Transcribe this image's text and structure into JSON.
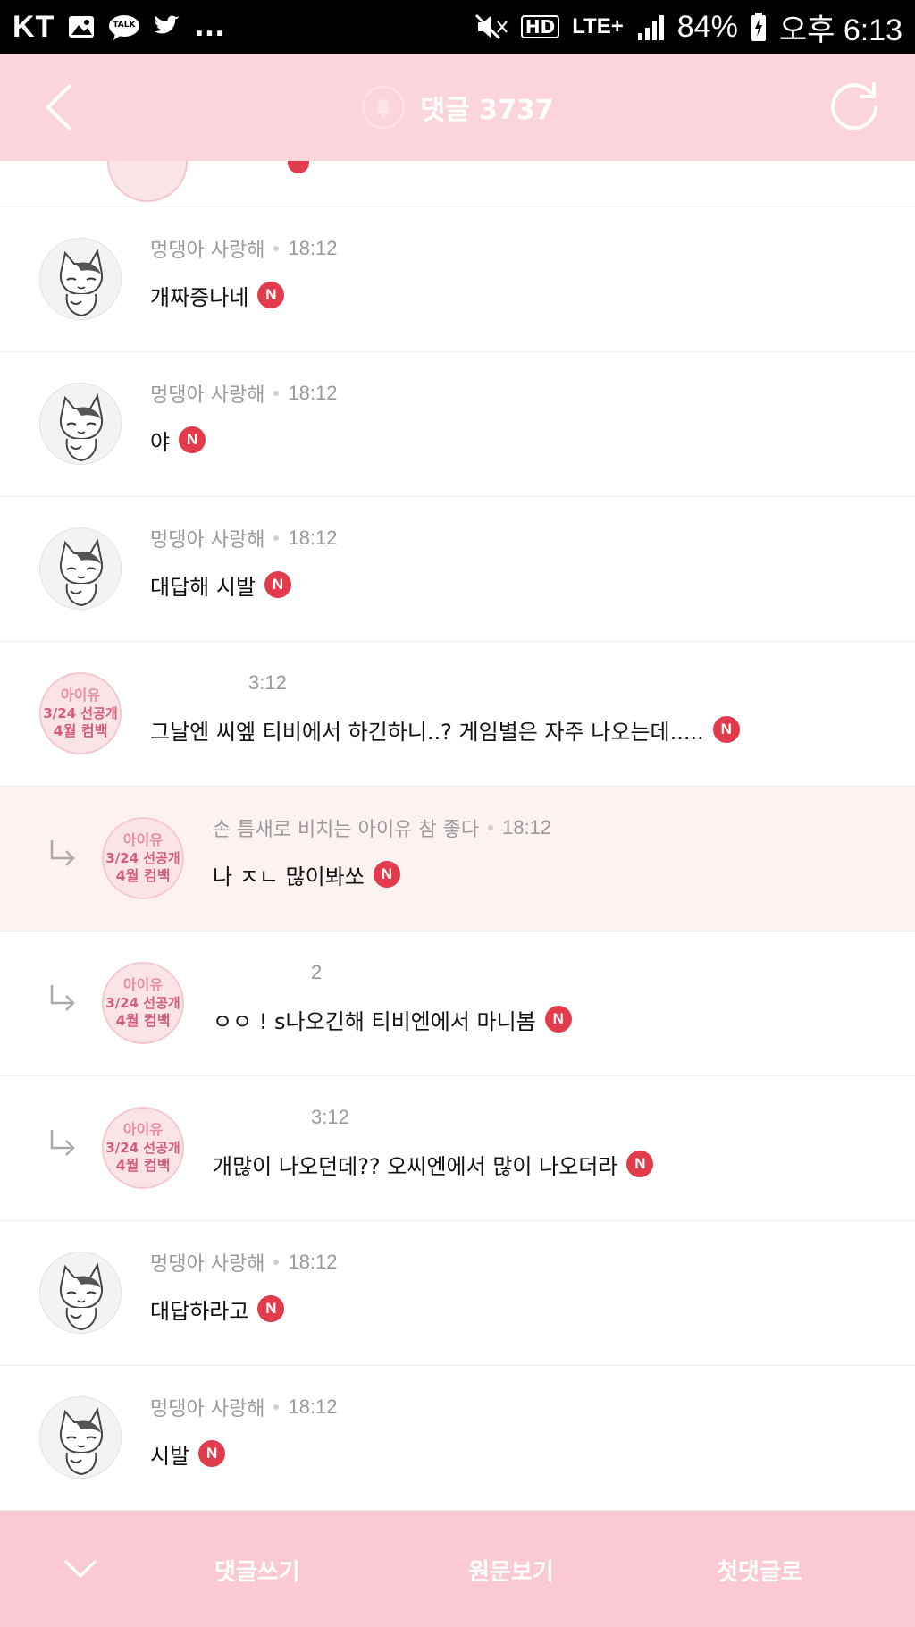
{
  "status_bar": {
    "carrier": "KT",
    "ellipsis": "...",
    "talk_label": "TALK",
    "hd_label": "HD",
    "network": "LTE+",
    "battery": "84%",
    "time": "오후 6:13"
  },
  "header": {
    "title": "댓글 3737"
  },
  "comments": [
    {
      "name": "멍댕아 사랑해",
      "time": "18:12",
      "text": "개짜증나네",
      "badge": "N",
      "avatar": "cat"
    },
    {
      "name": "멍댕아 사랑해",
      "time": "18:12",
      "text": "야",
      "badge": "N",
      "avatar": "cat"
    },
    {
      "name": "멍댕아 사랑해",
      "time": "18:12",
      "text": "대답해 시발",
      "badge": "N",
      "avatar": "cat"
    },
    {
      "name": "",
      "time": "3:12",
      "text": "그날엔 씨엪 티비에서 하긴하니..? 게임별은 자주 나오는데.....",
      "badge": "N",
      "avatar": "iu"
    },
    {
      "name": "손 틈새로 비치는 아이유 참 좋다",
      "time": "18:12",
      "text": "나 ㅈㄴ 많이봐쏘",
      "badge": "N",
      "avatar": "iu",
      "reply": true
    },
    {
      "name": "",
      "time": "2",
      "text": "ㅇㅇ ! s나오긴해 티비엔에서 마니봄",
      "badge": "N",
      "avatar": "iu",
      "reply": true
    },
    {
      "name": "",
      "time": "3:12",
      "text": "개많이 나오던데?? 오씨엔에서 많이 나오더라",
      "badge": "N",
      "avatar": "iu",
      "reply": true
    },
    {
      "name": "멍댕아 사랑해",
      "time": "18:12",
      "text": "대답하라고",
      "badge": "N",
      "avatar": "cat"
    },
    {
      "name": "멍댕아 사랑해",
      "time": "18:12",
      "text": "시발",
      "badge": "N",
      "avatar": "cat"
    }
  ],
  "iu_avatar": {
    "line1": "아이유",
    "line2": "3/24 선공개",
    "line3": "4월 컴백"
  },
  "bottom_bar": {
    "write": "댓글쓰기",
    "original": "원문보기",
    "first": "첫댓글로"
  }
}
